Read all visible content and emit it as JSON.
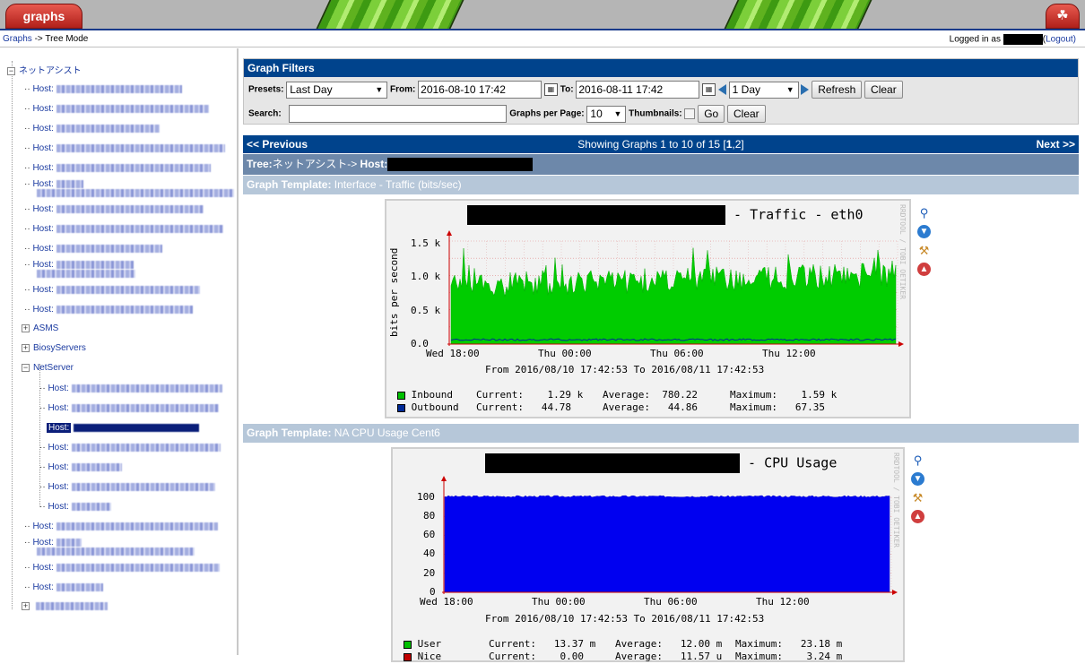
{
  "header": {
    "app_tab": "graphs",
    "tree_tab_icon": "tree-icon",
    "breadcrumb_link": "Graphs",
    "breadcrumb_sep": " -> ",
    "breadcrumb_current": "Tree Mode",
    "login_prefix": "Logged in as ",
    "logout": "Logout)"
  },
  "sidebar": {
    "root": "ネットアシスト",
    "host_prefix": "Host:",
    "extra_groups": [
      "ASMS",
      "BiosyServers",
      "NetServer"
    ]
  },
  "filters": {
    "title": "Graph Filters",
    "presets_label": "Presets:",
    "preset_value": "Last Day",
    "from_label": "From:",
    "from_value": "2016-08-10 17:42",
    "to_label": "To:",
    "to_value": "2016-08-11 17:42",
    "timespan_value": "1 Day",
    "refresh": "Refresh",
    "clear": "Clear",
    "search_label": "Search:",
    "search_value": "",
    "graphs_per_page_label": "Graphs per Page:",
    "graphs_per_page_value": "10",
    "thumbnails_label": "Thumbnails:",
    "go": "Go",
    "clear2": "Clear"
  },
  "pager": {
    "previous": "<< Previous",
    "showing": "Showing Graphs 1 to 10 of 15 [",
    "page1": "1",
    "page_sep": ",",
    "page2": "2",
    "showing_end": "]",
    "next": "Next >>"
  },
  "tree_bar": {
    "tree_label": "Tree:",
    "tree_value": "ネットアシスト-> ",
    "host_label": "Host:"
  },
  "templates": [
    {
      "label": "Graph Template:",
      "value": " Interface - Traffic (bits/sec)"
    },
    {
      "label": "Graph Template:",
      "value": " NA CPU Usage Cent6"
    }
  ],
  "graphs": [
    {
      "title_suffix": "- Traffic - eth0",
      "ylabel": "bits per second",
      "watermark": "RRDTOOL / TOBI OETIKER",
      "yticks": [
        "1.5 k",
        "1.0 k",
        "0.5 k",
        "0.0"
      ],
      "xticks": [
        "Wed 18:00",
        "Thu 00:00",
        "Thu 06:00",
        "Thu 12:00"
      ],
      "range": "From 2016/08/10 17:42:53 To 2016/08/11 17:42:53",
      "legend": [
        {
          "name": "Inbound",
          "current": "Current:    1.29 k",
          "average": "Average:  780.22",
          "maximum": "Maximum:    1.59 k",
          "color": "#00c000"
        },
        {
          "name": "Outbound",
          "current": "Current:   44.78",
          "average": "Average:   44.86",
          "maximum": "Maximum:   67.35",
          "color": "#002a97"
        }
      ]
    },
    {
      "title_suffix": "- CPU Usage",
      "watermark": "RRDTOOL / TOBI OETIKER",
      "yticks": [
        "100",
        "80",
        "60",
        "40",
        "20",
        "0"
      ],
      "xticks": [
        "Wed 18:00",
        "Thu 00:00",
        "Thu 06:00",
        "Thu 12:00"
      ],
      "range": "From 2016/08/10 17:42:53 To 2016/08/11 17:42:53",
      "legend": [
        {
          "name": "User",
          "current": "Current:   13.37 m",
          "average": "Average:   12.00 m",
          "maximum": "Maximum:   23.18 m",
          "color": "#00c000"
        },
        {
          "name": "Nice",
          "current": "Current:    0.00",
          "average": "Average:   11.57 u",
          "maximum": "Maximum:    3.24 m",
          "color": "#c00000"
        }
      ]
    }
  ],
  "colors": {
    "nav_dark": "#00438c",
    "tree_bar": "#6d88aa",
    "template_bar": "#b6c7d9",
    "inbound": "#00c000",
    "cpu_user": "#0000ff"
  }
}
